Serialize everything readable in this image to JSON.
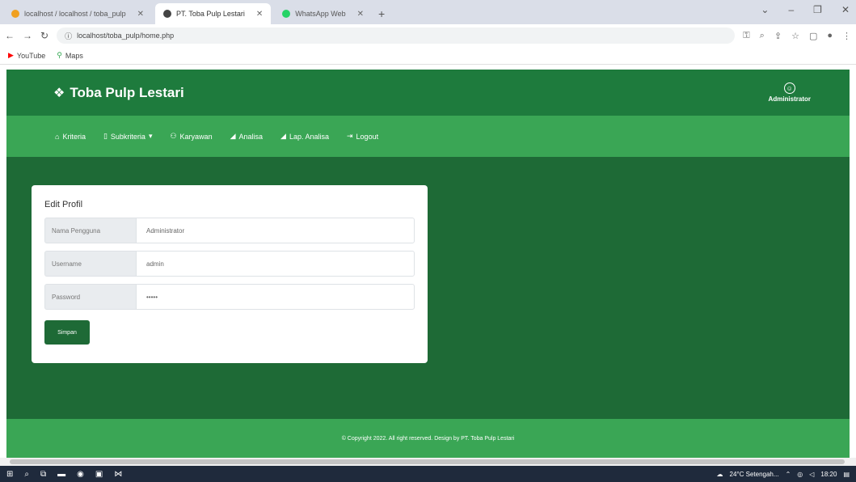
{
  "browser": {
    "tabs": [
      {
        "title": "localhost / localhost / toba_pulp",
        "favicon_color": "#f0a020",
        "active": false
      },
      {
        "title": "PT. Toba Pulp Lestari",
        "favicon_color": "#444444",
        "active": true
      },
      {
        "title": "WhatsApp Web",
        "favicon_color": "#25d366",
        "active": false
      }
    ],
    "new_tab": "+",
    "url": "localhost/toba_pulp/home.php",
    "bookmarks": [
      {
        "label": "YouTube",
        "color": "#ff0000"
      },
      {
        "label": "Maps",
        "color": "#34a853"
      }
    ]
  },
  "app": {
    "brand": "Toba Pulp Lestari",
    "user": "Administrator",
    "nav": [
      {
        "label": "Kriteria",
        "icon": "home-icon"
      },
      {
        "label": "Subkriteria",
        "icon": "document-icon",
        "dropdown": true
      },
      {
        "label": "Karyawan",
        "icon": "user-icon"
      },
      {
        "label": "Analisa",
        "icon": "chart-icon"
      },
      {
        "label": "Lap. Analisa",
        "icon": "chart-icon"
      },
      {
        "label": "Logout",
        "icon": "logout-icon"
      }
    ],
    "form": {
      "title": "Edit Profil",
      "fields": [
        {
          "label": "Nama Pengguna",
          "value": "Administrator"
        },
        {
          "label": "Username",
          "value": "admin"
        },
        {
          "label": "Password",
          "value": "•••••"
        }
      ],
      "submit_label": "Simpan"
    },
    "footer": "© Copyright 2022. All right reserved. Design by PT. Toba Pulp Lestari"
  },
  "taskbar": {
    "weather": "24°C Setengah...",
    "time": "18:20"
  },
  "colors": {
    "header": "#1e7b3d",
    "nav": "#3aa655",
    "main": "#1e6a36"
  }
}
